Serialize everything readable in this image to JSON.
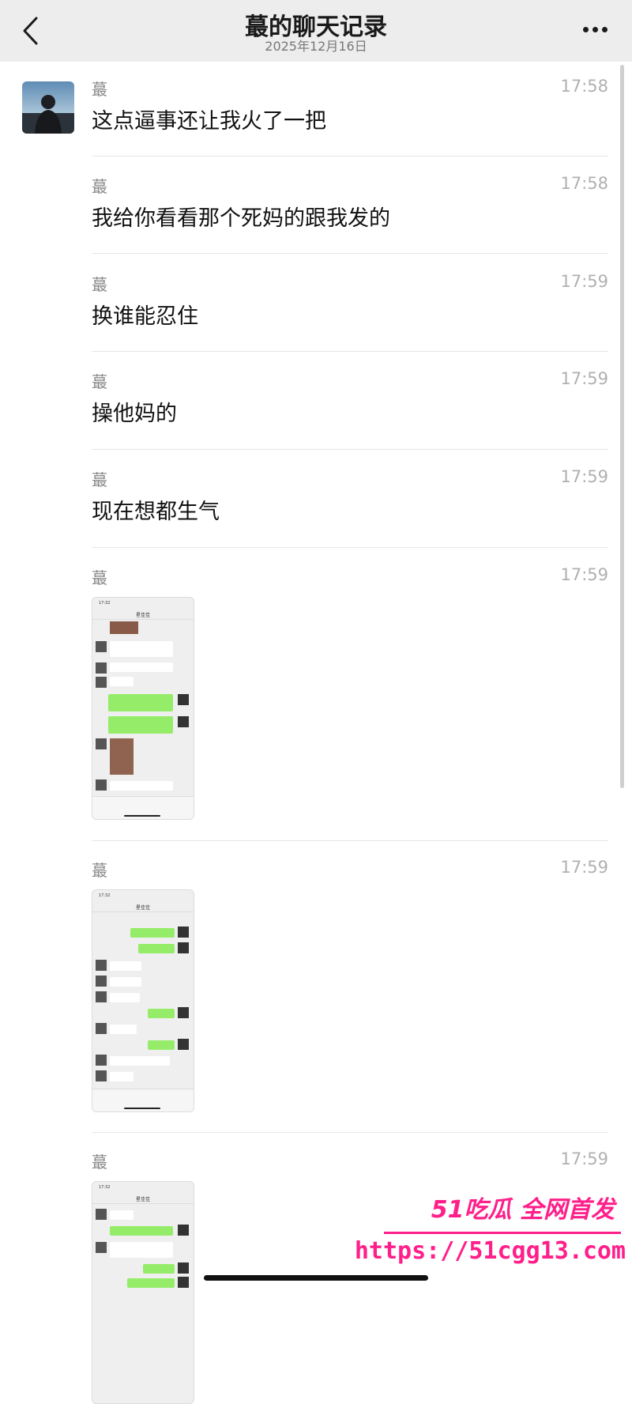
{
  "header": {
    "title": "蕞的聊天记录",
    "date": "2025年12月16日"
  },
  "records": [
    {
      "sender": "蕞",
      "time": "17:58",
      "text": "这点逼事还让我火了一把"
    },
    {
      "sender": "蕞",
      "time": "17:58",
      "text": "我给你看看那个死妈的跟我发的"
    },
    {
      "sender": "蕞",
      "time": "17:59",
      "text": "换谁能忍住"
    },
    {
      "sender": "蕞",
      "time": "17:59",
      "text": "操他妈的"
    },
    {
      "sender": "蕞",
      "time": "17:59",
      "text": "现在想都生气"
    },
    {
      "sender": "蕞",
      "time": "17:59",
      "image": "chat-screenshot",
      "thumb": {
        "time": "17:32",
        "title": "星佳佳"
      }
    },
    {
      "sender": "蕞",
      "time": "17:59",
      "image": "chat-screenshot",
      "thumb": {
        "time": "17:32",
        "title": "星佳佳"
      }
    },
    {
      "sender": "蕞",
      "time": "17:59",
      "image": "chat-screenshot",
      "thumb": {
        "time": "17:32",
        "title": "星佳佳"
      }
    }
  ],
  "watermark": {
    "main": "51吃瓜 全网首发",
    "url": "https://51cgg13.com"
  },
  "colors": {
    "header_bg": "#ededed",
    "bubble_green": "#95ec69",
    "watermark": "#ff1f8a"
  },
  "icons": [
    "back-chevron-icon",
    "more-dots-icon"
  ]
}
